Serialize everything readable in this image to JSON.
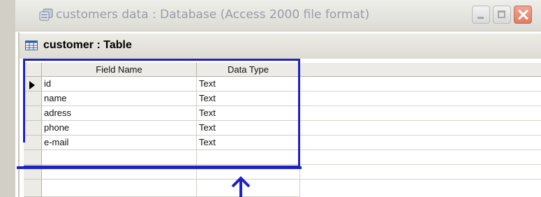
{
  "outer_window": {
    "title": "customers data : Database (Access 2000 file format)",
    "icon": "database-window-icon",
    "controls": [
      "minimize",
      "maximize",
      "close"
    ]
  },
  "table_window": {
    "title": "customer : Table",
    "icon": "table-icon"
  },
  "design_grid": {
    "columns": [
      "Field Name",
      "Data Type"
    ],
    "rows": [
      {
        "field": "id",
        "type": "Text"
      },
      {
        "field": "name",
        "type": "Text"
      },
      {
        "field": "adress",
        "type": "Text"
      },
      {
        "field": "phone",
        "type": "Text"
      },
      {
        "field": "e-mail",
        "type": "Text"
      }
    ],
    "current_row_indicator": "triangle-right-icon"
  },
  "annotation": {
    "color": "#1d22c8",
    "shape": "rectangle-highlight",
    "pointer": "up-arrow-icon"
  }
}
